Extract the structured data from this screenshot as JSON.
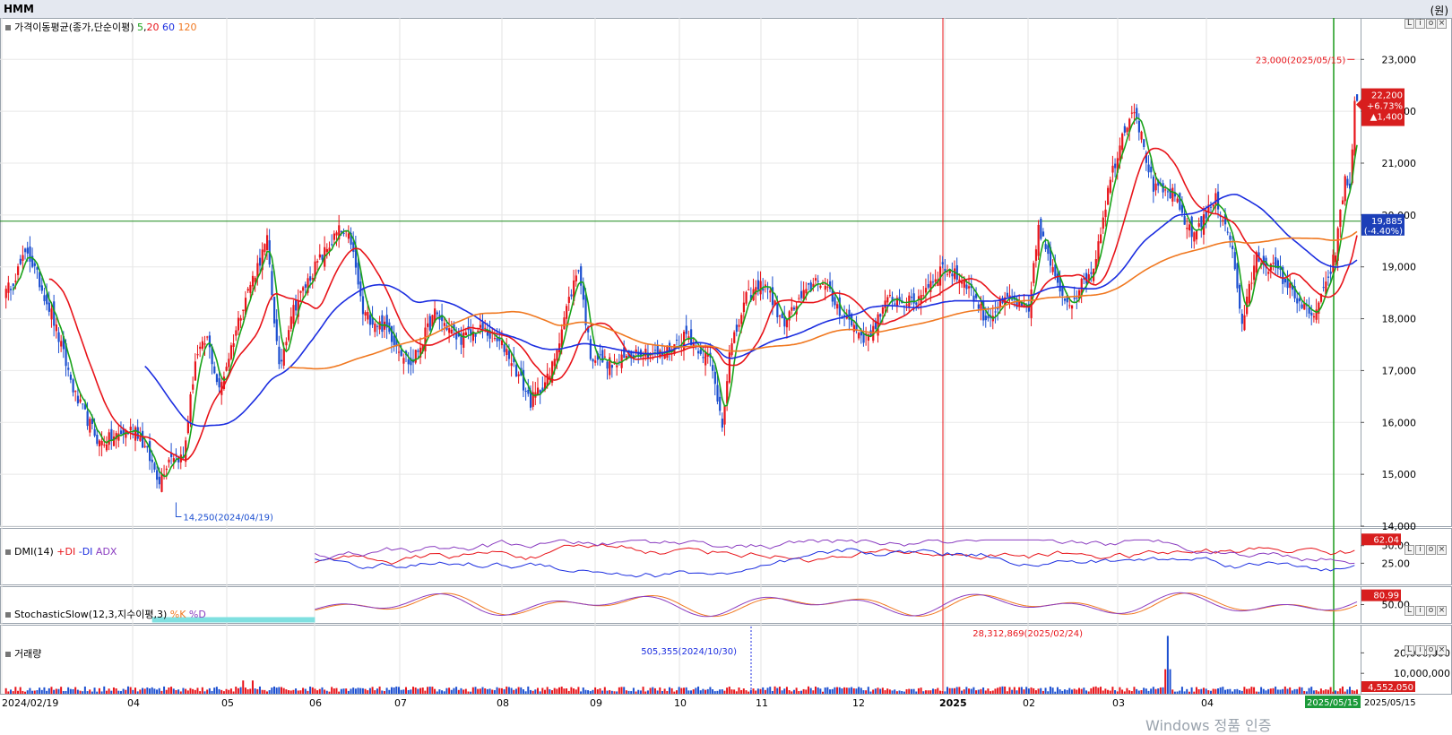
{
  "header": {
    "ticker": "HMM",
    "unit": "(원)"
  },
  "price_panel": {
    "title": "가격이동평균(종가,단순이평)",
    "ma_periods": [
      {
        "label": "5",
        "color": "#1aa31a"
      },
      {
        "label": "20",
        "color": "#e8141a"
      },
      {
        "label": "60",
        "color": "#1c2ee0"
      },
      {
        "label": "120",
        "color": "#f07820"
      }
    ],
    "current_price": "22,200",
    "change_pct": "+6.73%",
    "change_abs": "▲1,400",
    "ref_value": "19,885",
    "ref_pct": "(-4.40%)",
    "high_annotation": "23,000(2025/05/15)",
    "low_annotation": "14,250(2024/04/19)",
    "colors": {
      "up": "#e8141a",
      "down": "#1c4fd0",
      "ref_line": "#1a8a1a"
    }
  },
  "dmi_panel": {
    "title": "DMI(14)",
    "legend": [
      {
        "label": "+DI",
        "color": "#e8141a"
      },
      {
        "label": "-DI",
        "color": "#1c2ee0"
      },
      {
        "label": "ADX",
        "color": "#8a3cc0"
      }
    ],
    "value_badge": "62.04"
  },
  "stoch_panel": {
    "title": "StochasticSlow(12,3,지수이평,3)",
    "legend": [
      {
        "label": "%K",
        "color": "#f07820"
      },
      {
        "label": "%D",
        "color": "#8a3cc0"
      }
    ],
    "value_badge": "80.99"
  },
  "volume_panel": {
    "title": "거래량",
    "value_badge": "4,552,050",
    "annotations": [
      {
        "text": "505,355(2024/10/30)",
        "color": "#1c2ee0"
      },
      {
        "text": "28,312,869(2025/02/24)",
        "color": "#e8141a"
      }
    ]
  },
  "x_axis": {
    "labels": [
      "2024/02/19",
      "04",
      "05",
      "06",
      "07",
      "08",
      "09",
      "10",
      "11",
      "12",
      "2025",
      "02",
      "03",
      "04"
    ],
    "end_label_current": "2025/05/15",
    "end_label_right": "2025/05/15"
  },
  "watermark": "Windows 정품 인증",
  "chart_data": {
    "type": "candlestick",
    "title": "HMM",
    "y_axis": {
      "min": 14000,
      "max": 23800,
      "ticks": [
        "23,000",
        "22,000",
        "21,000",
        "20,000",
        "19,000",
        "18,000",
        "17,000",
        "16,000",
        "15,000",
        "14,000"
      ]
    },
    "dmi_axis": {
      "ticks": [
        "50.00",
        "25.00"
      ]
    },
    "stoch_axis": {
      "ticks": [
        "50.00"
      ]
    },
    "volume_axis": {
      "ticks": [
        "20,000,000",
        "10,000,000"
      ]
    },
    "close_keypoints": [
      [
        0,
        18400
      ],
      [
        10,
        19300
      ],
      [
        20,
        18100
      ],
      [
        30,
        16500
      ],
      [
        40,
        15600
      ],
      [
        55,
        15900
      ],
      [
        65,
        14900
      ],
      [
        70,
        15400
      ],
      [
        75,
        15300
      ],
      [
        80,
        17200
      ],
      [
        85,
        17600
      ],
      [
        90,
        16600
      ],
      [
        100,
        18300
      ],
      [
        110,
        19500
      ],
      [
        115,
        17000
      ],
      [
        120,
        18100
      ],
      [
        130,
        19000
      ],
      [
        140,
        19700
      ],
      [
        145,
        19500
      ],
      [
        150,
        18100
      ],
      [
        160,
        17800
      ],
      [
        170,
        17100
      ],
      [
        180,
        18100
      ],
      [
        190,
        17600
      ],
      [
        200,
        17800
      ],
      [
        210,
        17400
      ],
      [
        220,
        16400
      ],
      [
        228,
        16900
      ],
      [
        235,
        18200
      ],
      [
        240,
        19000
      ],
      [
        245,
        17300
      ],
      [
        255,
        17100
      ],
      [
        265,
        17400
      ],
      [
        275,
        17300
      ],
      [
        285,
        17700
      ],
      [
        295,
        17200
      ],
      [
        300,
        16000
      ],
      [
        303,
        17300
      ],
      [
        310,
        18400
      ],
      [
        318,
        18700
      ],
      [
        325,
        17900
      ],
      [
        340,
        18800
      ],
      [
        350,
        18100
      ],
      [
        360,
        17600
      ],
      [
        370,
        18400
      ],
      [
        380,
        18300
      ],
      [
        392,
        19000
      ],
      [
        402,
        18700
      ],
      [
        410,
        18000
      ],
      [
        420,
        18400
      ],
      [
        428,
        18100
      ],
      [
        432,
        19800
      ],
      [
        440,
        18600
      ],
      [
        445,
        18300
      ],
      [
        455,
        19000
      ],
      [
        462,
        20700
      ],
      [
        468,
        21700
      ],
      [
        472,
        22100
      ],
      [
        480,
        20500
      ],
      [
        488,
        20400
      ],
      [
        496,
        19600
      ],
      [
        506,
        20300
      ],
      [
        512,
        19600
      ],
      [
        517,
        17900
      ],
      [
        523,
        19200
      ],
      [
        532,
        18900
      ],
      [
        540,
        18400
      ],
      [
        546,
        18000
      ],
      [
        552,
        18600
      ],
      [
        556,
        19300
      ],
      [
        560,
        20700
      ],
      [
        562,
        20500
      ],
      [
        564,
        22200
      ]
    ],
    "volume_spikes": [
      {
        "index": 163,
        "label": "505,355"
      },
      {
        "index": 486,
        "value": 28312869
      }
    ]
  }
}
